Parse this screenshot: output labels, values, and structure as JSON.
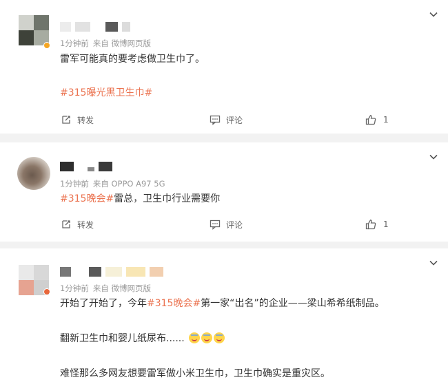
{
  "colors": {
    "link": "#eb7350",
    "meta": "#9a9a9a",
    "text": "#333333",
    "background": "#f2f2f2"
  },
  "posts": [
    {
      "time": "1分钟前",
      "source": "来自 微博网页版",
      "text": "雷军可能真的要考虑做卫生巾了。",
      "hashtag": "#315曝光黑卫生巾#",
      "repost": "转发",
      "comment": "评论",
      "likes": "1"
    },
    {
      "time": "1分钟前",
      "source": "来自 OPPO A97 5G",
      "hashtag": "#315晚会#",
      "text": "雷总，卫生巾行业需要你",
      "repost": "转发",
      "comment": "评论",
      "likes": "1"
    },
    {
      "time": "1分钟前",
      "source": "来自 微博网页版",
      "line1_pre": "开始了开始了，今年",
      "hashtag": "#315晚会#",
      "line1_post": "第一家“出名”的企业——梁山希希纸制品。",
      "line2": "翻新卫生巾和婴儿纸尿布......",
      "line3": "难怪那么多网友想要雷军做小米卫生巾，卫生巾确实是重灾区。"
    }
  ],
  "icons": [
    "chevron-down-icon",
    "repost-icon",
    "comment-icon",
    "thumbs-up-icon",
    "laugh-cry-emoji"
  ]
}
